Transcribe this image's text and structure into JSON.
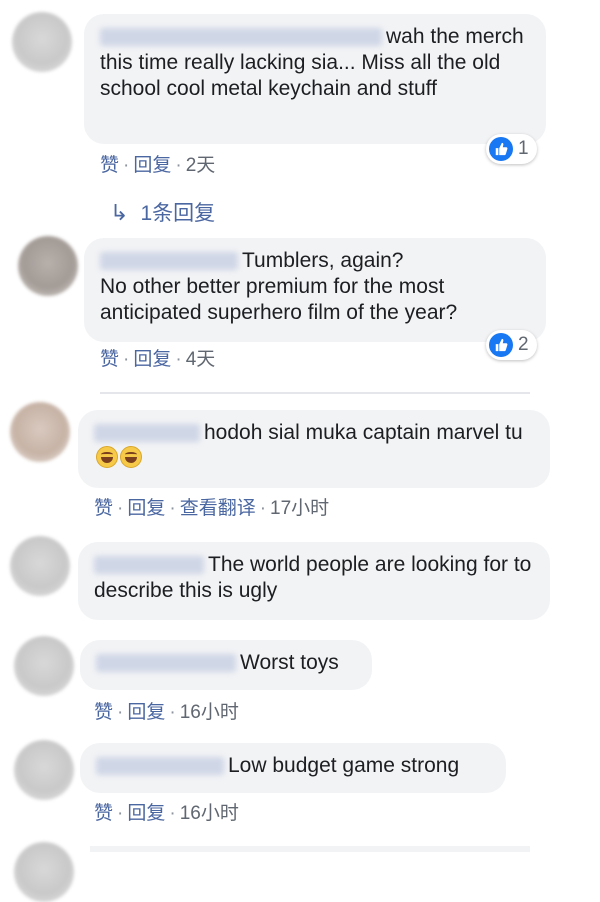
{
  "actions": {
    "like": "赞",
    "reply": "回复",
    "translate": "查看翻译",
    "separator": "·"
  },
  "comments": [
    {
      "text": "wah the merch this time really lacking sia... Miss all the old school cool metal keychain and stuff",
      "time": "2天",
      "reactions": "1",
      "replies_label": "1条回复"
    },
    {
      "text_line1": "Tumblers, again?",
      "text_rest": "No other better premium for the most anticipated superhero film of the year?",
      "time": "4天",
      "reactions": "2"
    },
    {
      "text": "hodoh sial muka captain marvel tu",
      "time": "17小时",
      "emoji": "rolling-on-floor-laughing-emoji"
    },
    {
      "text": "The world people are looking for to describe this is ugly"
    },
    {
      "text": "Worst toys",
      "time": "16小时"
    },
    {
      "text": "Low budget game strong",
      "time": "16小时"
    }
  ],
  "colors": {
    "bubble": "#f2f3f5",
    "link": "#4b67a1",
    "like_blue": "#1877f2"
  }
}
